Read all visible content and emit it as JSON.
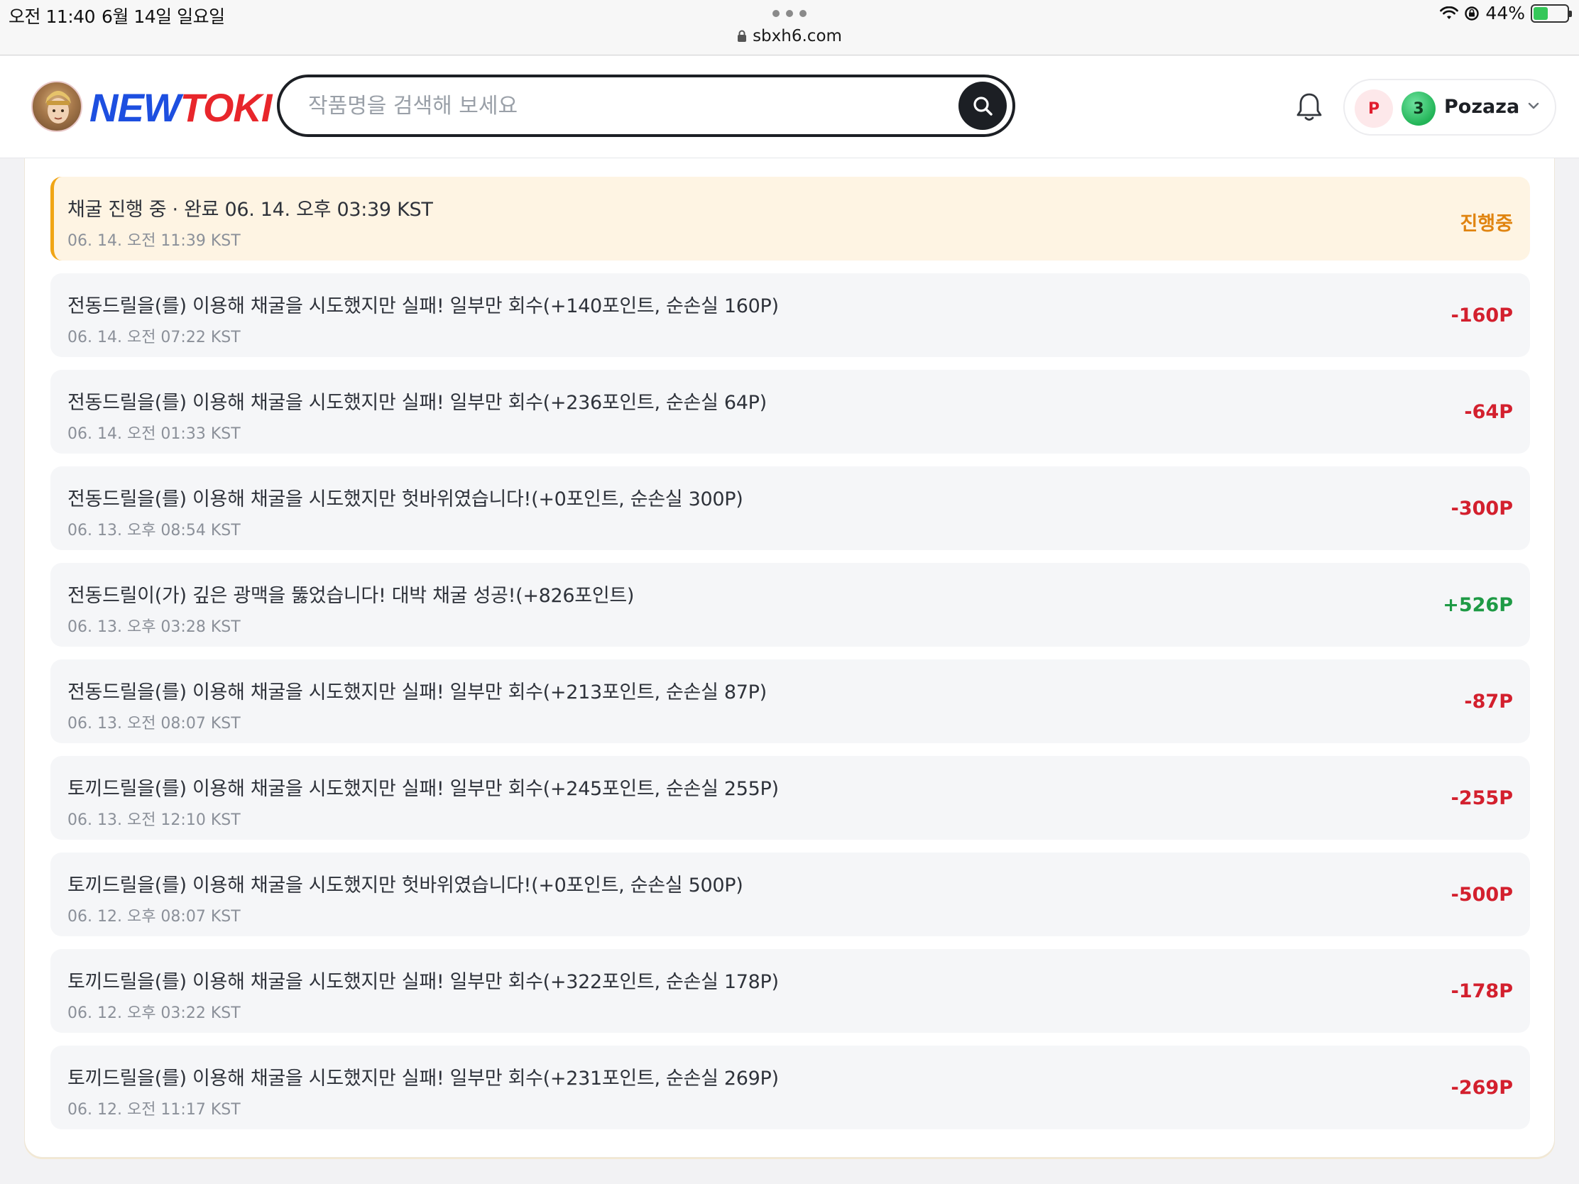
{
  "status_bar": {
    "time": "오전 11:40",
    "date": "6월 14일 일요일",
    "url": "sbxh6.com",
    "battery": "44%",
    "battery_level": 0.44
  },
  "header": {
    "logo_part1": "NEW",
    "logo_part2": "TOKI",
    "search_placeholder": "작품명을 검색해 보세요",
    "user": {
      "points_badge": "P",
      "level": "3",
      "name": "Pozaza"
    }
  },
  "history": [
    {
      "text": "채굴 진행 중 · 완료 06. 14. 오후 03:39 KST",
      "date": "06. 14. 오전 11:39 KST",
      "amount": "진행중",
      "kind": "progress"
    },
    {
      "text": "전동드릴을(를) 이용해 채굴을 시도했지만 실패! 일부만 회수(+140포인트, 순손실 160P)",
      "date": "06. 14. 오전 07:22 KST",
      "amount": "-160P",
      "kind": "neg"
    },
    {
      "text": "전동드릴을(를) 이용해 채굴을 시도했지만 실패! 일부만 회수(+236포인트, 순손실 64P)",
      "date": "06. 14. 오전 01:33 KST",
      "amount": "-64P",
      "kind": "neg"
    },
    {
      "text": "전동드릴을(를) 이용해 채굴을 시도했지만 헛바위였습니다!(+0포인트, 순손실 300P)",
      "date": "06. 13. 오후 08:54 KST",
      "amount": "-300P",
      "kind": "neg"
    },
    {
      "text": "전동드릴이(가) 깊은 광맥을 뚫었습니다! 대박 채굴 성공!(+826포인트)",
      "date": "06. 13. 오후 03:28 KST",
      "amount": "+526P",
      "kind": "pos"
    },
    {
      "text": "전동드릴을(를) 이용해 채굴을 시도했지만 실패! 일부만 회수(+213포인트, 순손실 87P)",
      "date": "06. 13. 오전 08:07 KST",
      "amount": "-87P",
      "kind": "neg"
    },
    {
      "text": "토끼드릴을(를) 이용해 채굴을 시도했지만 실패! 일부만 회수(+245포인트, 순손실 255P)",
      "date": "06. 13. 오전 12:10 KST",
      "amount": "-255P",
      "kind": "neg"
    },
    {
      "text": "토끼드릴을(를) 이용해 채굴을 시도했지만 헛바위였습니다!(+0포인트, 순손실 500P)",
      "date": "06. 12. 오후 08:07 KST",
      "amount": "-500P",
      "kind": "neg"
    },
    {
      "text": "토끼드릴을(를) 이용해 채굴을 시도했지만 실패! 일부만 회수(+322포인트, 순손실 178P)",
      "date": "06. 12. 오후 03:22 KST",
      "amount": "-178P",
      "kind": "neg"
    },
    {
      "text": "토끼드릴을(를) 이용해 채굴을 시도했지만 실패! 일부만 회수(+231포인트, 순손실 269P)",
      "date": "06. 12. 오전 11:17 KST",
      "amount": "-269P",
      "kind": "neg"
    }
  ],
  "colors": {
    "negative": "#d3202e",
    "positive": "#1e9a45",
    "in_progress": "#e08410",
    "logo_blue": "#1d4fe0",
    "logo_red": "#e8262b"
  },
  "icons": {
    "search": "search-icon",
    "bell": "bell-icon",
    "caret": "chevron-down-icon",
    "lock": "lock-icon",
    "wifi": "wifi-icon",
    "rotation_lock": "rotation-lock-icon",
    "battery": "battery-icon"
  }
}
